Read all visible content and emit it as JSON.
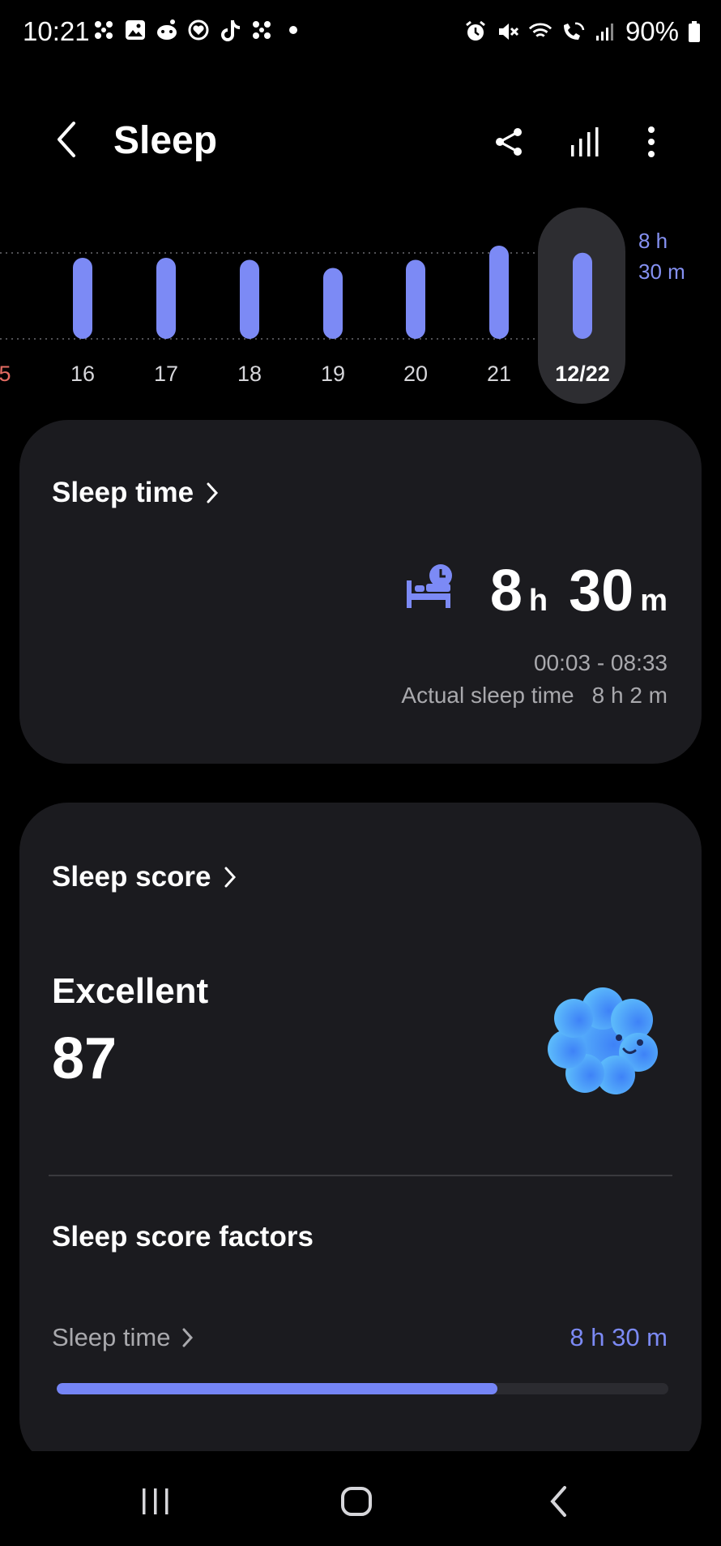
{
  "status_bar": {
    "time": "10:21",
    "battery": "90%",
    "left_icons": [
      "fan-icon",
      "gallery-icon",
      "reddit-icon",
      "heart-circle-icon",
      "tiktok-icon",
      "fan-icon",
      "dot-icon"
    ],
    "right_icons": [
      "alarm-icon",
      "mute-icon",
      "wifi-icon",
      "wifi-call-icon",
      "signal-icon",
      "battery-icon"
    ]
  },
  "header": {
    "title": "Sleep",
    "actions": [
      "share-icon",
      "chart-icon",
      "more-icon"
    ]
  },
  "chart_data": {
    "type": "bar",
    "categories": [
      "5",
      "16",
      "17",
      "18",
      "19",
      "20",
      "21",
      "12/22"
    ],
    "values_hours": [
      null,
      8.0,
      8.0,
      7.8,
      7.0,
      7.8,
      9.2,
      8.5
    ],
    "selected_category": "12/22",
    "goal_label": [
      "8 h",
      "30 m"
    ],
    "colors": {
      "bar": "#7c8af5",
      "weekend_label": "#e36b62",
      "label": "#d6d6da"
    }
  },
  "sleep_time_card": {
    "title": "Sleep time",
    "hours": "8",
    "hours_unit": "h",
    "minutes": "30",
    "minutes_unit": "m",
    "time_range": "00:03 - 08:33",
    "actual_label": "Actual sleep time",
    "actual_value": "8 h 2 m"
  },
  "sleep_score_card": {
    "title": "Sleep score",
    "rating": "Excellent",
    "score": "87",
    "factors_title": "Sleep score factors",
    "factor": {
      "label": "Sleep time",
      "value": "8 h 30 m",
      "progress": 0.72
    }
  },
  "accent": "#7c8af5"
}
